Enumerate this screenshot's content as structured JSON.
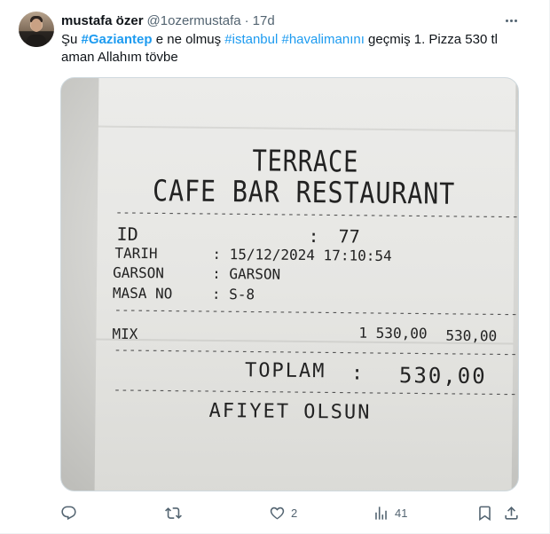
{
  "tweet": {
    "author_name": "mustafa özer",
    "author_handle": "@1ozermustafa",
    "separator": "·",
    "time": "17d",
    "text_parts": {
      "p1": "Şu ",
      "h1": "#Gaziantep",
      "p2": " e ne olmuş ",
      "h2": "#istanbul",
      "p3": " ",
      "h3": "#havalimanını",
      "p4": " geçmiş 1. Pizza 530 tl aman Allahım tövbe"
    }
  },
  "receipt": {
    "title_line1": "TERRACE",
    "title_line2": "CAFE BAR RESTAURANT",
    "dash_line": "--------------------------------------------------------------",
    "id_label": "ID",
    "id_sep": ":",
    "id_value": "77",
    "date_label": "TARIH",
    "date_value": ": 15/12/2024  17:10:54",
    "waiter_label": "GARSON",
    "waiter_value": ": GARSON",
    "table_label": "MASA NO",
    "table_value": ": S-8",
    "item_name": "MIX",
    "item_qty_price": "1 530,00",
    "item_total": "530,00",
    "total_label": "TOPLAM",
    "total_sep": ":",
    "total_value": "530,00",
    "footer": "AFIYET OLSUN"
  },
  "actions": {
    "reply_count": "",
    "retweet_count": "",
    "like_count": "2",
    "views_count": "41"
  },
  "icons": [
    "more-icon",
    "reply-icon",
    "retweet-icon",
    "like-icon",
    "views-icon",
    "bookmark-icon",
    "share-icon"
  ],
  "colors": {
    "hashtag": "#1d9bf0",
    "secondary_text": "#536471",
    "primary_text": "#0f1419"
  }
}
